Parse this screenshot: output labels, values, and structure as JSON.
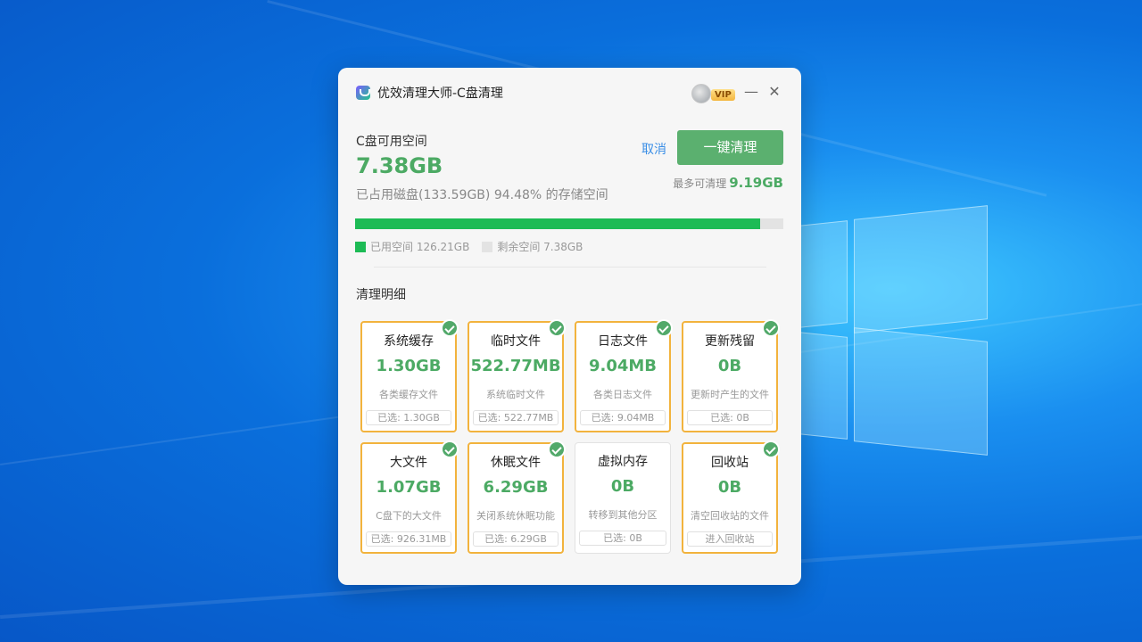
{
  "window": {
    "title": "优效清理大师-C盘清理",
    "vip_badge": "VIP"
  },
  "summary": {
    "label": "C盘可用空间",
    "free_space": "7.38GB",
    "used_desc": "已占用磁盘(133.59GB) 94.48% 的存储空间",
    "cancel_label": "取消",
    "clean_label": "一键清理",
    "max_clean_label": "最多可清理",
    "max_clean_value": "9.19GB",
    "used_fraction": 0.9448
  },
  "legend": {
    "used_label": "已用空间 126.21GB",
    "free_label": "剩余空间 7.38GB",
    "used_color": "#1dbb55",
    "free_color": "#e3e3e3"
  },
  "details": {
    "title": "清理明细",
    "cards": [
      {
        "title": "系统缓存",
        "size": "1.30GB",
        "desc": "各类缓存文件",
        "selected_label": "已选: 1.30GB",
        "checked": true
      },
      {
        "title": "临时文件",
        "size": "522.77MB",
        "desc": "系统临时文件",
        "selected_label": "已选: 522.77MB",
        "checked": true
      },
      {
        "title": "日志文件",
        "size": "9.04MB",
        "desc": "各类日志文件",
        "selected_label": "已选: 9.04MB",
        "checked": true
      },
      {
        "title": "更新残留",
        "size": "0B",
        "desc": "更新时产生的文件",
        "selected_label": "已选: 0B",
        "checked": true
      },
      {
        "title": "大文件",
        "size": "1.07GB",
        "desc": "C盘下的大文件",
        "selected_label": "已选: 926.31MB",
        "checked": true
      },
      {
        "title": "休眠文件",
        "size": "6.29GB",
        "desc": "关闭系统休眠功能",
        "selected_label": "已选: 6.29GB",
        "checked": true
      },
      {
        "title": "虚拟内存",
        "size": "0B",
        "desc": "转移到其他分区",
        "selected_label": "已选: 0B",
        "checked": false
      },
      {
        "title": "回收站",
        "size": "0B",
        "desc": "清空回收站的文件",
        "selected_label": "进入回收站",
        "checked": true
      }
    ]
  },
  "colors": {
    "accent_green": "#4caa64",
    "button_green": "#5bb06f",
    "selected_border": "#f2b33d",
    "link_blue": "#3a8ee6"
  }
}
